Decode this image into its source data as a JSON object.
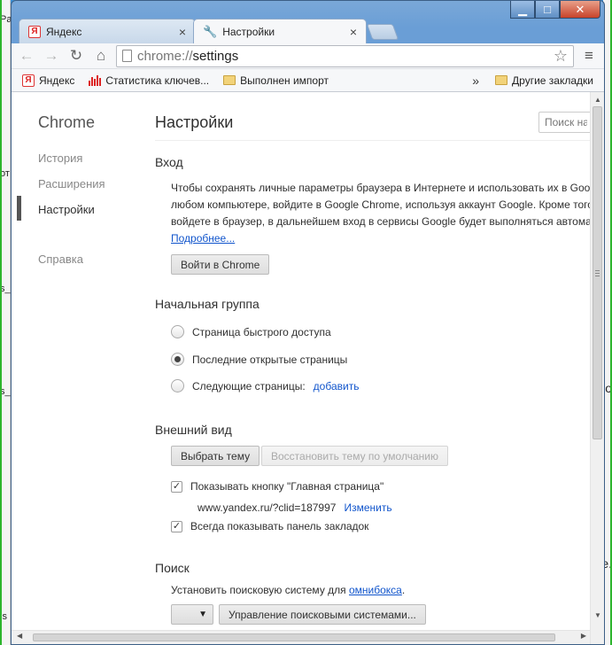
{
  "background": {
    "left_fragments": [
      "Pa",
      "от",
      "s_",
      "s_",
      "ls"
    ],
    "right_fragments": [
      "о",
      "e."
    ]
  },
  "tabs": [
    {
      "label": "Яндекс",
      "icon": "yandex-icon",
      "active": false
    },
    {
      "label": "Настройки",
      "icon": "wrench-icon",
      "active": true
    }
  ],
  "window_controls": {
    "minimize": "▁",
    "maximize": "□",
    "close": "✕"
  },
  "toolbar": {
    "back": "←",
    "forward": "→",
    "reload": "↻",
    "home": "⌂",
    "url_scheme": "chrome://",
    "url_host": "settings",
    "star": "☆",
    "menu": "≡"
  },
  "bookmarks": {
    "items": [
      {
        "label": "Яндекс",
        "icon": "yandex-icon"
      },
      {
        "label": "Статистика ключев...",
        "icon": "stats-icon"
      },
      {
        "label": "Выполнен импорт",
        "icon": "folder-icon"
      }
    ],
    "more": "»",
    "other": "Другие закладки"
  },
  "sidebar": {
    "brand": "Chrome",
    "items": [
      "История",
      "Расширения",
      "Настройки",
      "Справка"
    ],
    "selected": "Настройки"
  },
  "main": {
    "title": "Настройки",
    "search_placeholder": "Поиск настроек",
    "signin": {
      "title": "Вход",
      "lines": [
        "Чтобы сохранять личные параметры браузера в Интернете и использовать их в Google Chrome на",
        "любом компьютере, войдите в Google Chrome, используя аккаунт Google. Кроме того, после того как",
        "войдете в браузер, в дальнейшем вход в сервисы Google будет выполняться автоматически."
      ],
      "more_link": "Подробнее...",
      "button": "Войти в Chrome"
    },
    "startup": {
      "title": "Начальная группа",
      "options": [
        {
          "label": "Страница быстрого доступа",
          "checked": false
        },
        {
          "label": "Последние открытые страницы",
          "checked": true
        },
        {
          "label": "Следующие страницы:",
          "checked": false
        }
      ],
      "add_link": "добавить"
    },
    "appearance": {
      "title": "Внешний вид",
      "choose_theme": "Выбрать тему",
      "reset_theme": "Восстановить тему по умолчанию",
      "show_home": "Показывать кнопку \"Главная страница\"",
      "home_url": "www.yandex.ru/?clid=187997",
      "change_link": "Изменить",
      "show_bookmarks": "Всегда показывать панель закладок"
    },
    "search": {
      "title": "Поиск",
      "text": "Установить поисковую систему для",
      "omnibox_link": "омнибокса",
      "text_end": ".",
      "manage_button": "Управление поисковыми системами..."
    }
  },
  "colors": {
    "link": "#1155cc",
    "frame": "#6a9ed6",
    "close_button": "#c7432a"
  }
}
